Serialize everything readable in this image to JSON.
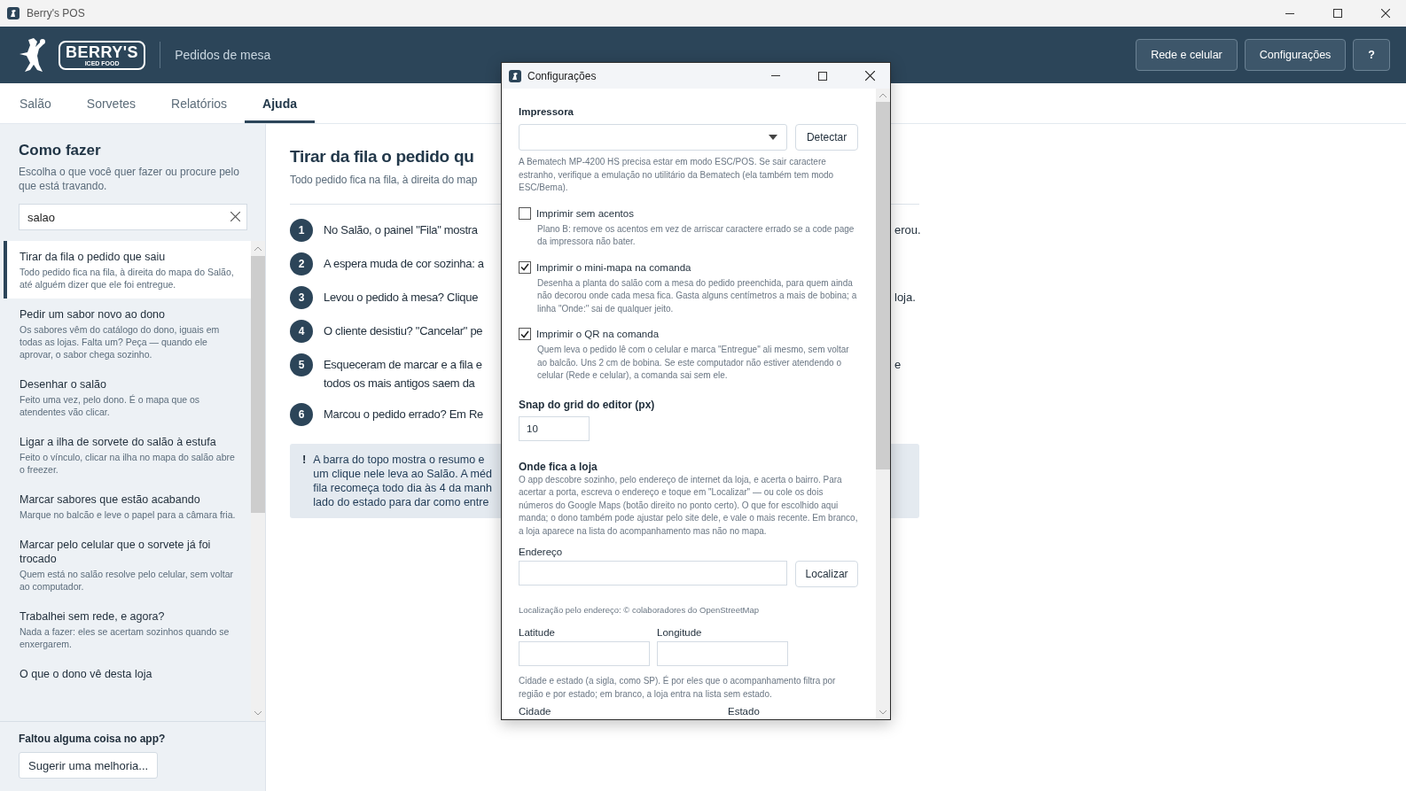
{
  "app_window": {
    "title": "Berry's POS"
  },
  "header": {
    "brand": "BERRY'S",
    "brand_sub": "ICED FOOD",
    "section": "Pedidos de mesa",
    "buttons": [
      "Rede e celular",
      "Configurações",
      "?"
    ]
  },
  "tabs": [
    {
      "label": "Salão",
      "selected": false
    },
    {
      "label": "Sorvetes",
      "selected": false
    },
    {
      "label": "Relatórios",
      "selected": false
    },
    {
      "label": "Ajuda",
      "selected": true
    }
  ],
  "sidebar": {
    "title": "Como fazer",
    "subtitle": "Escolha o que você quer fazer ou procure pelo que está travando.",
    "search": {
      "value": "salao"
    },
    "items": [
      {
        "title": "Tirar da fila o pedido que saiu",
        "description": "Todo pedido fica na fila, à direita do mapa do Salão, até alguém dizer que ele foi entregue.",
        "selected": true
      },
      {
        "title": "Pedir um sabor novo ao dono",
        "description": "Os sabores vêm do catálogo do dono, iguais em todas as lojas. Falta um? Peça — quando ele aprovar, o sabor chega sozinho.",
        "selected": false
      },
      {
        "title": "Desenhar o salão",
        "description": "Feito uma vez, pelo dono. É o mapa que os atendentes vão clicar.",
        "selected": false
      },
      {
        "title": "Ligar a ilha de sorvete do salão à estufa",
        "description": "Feito o vínculo, clicar na ilha no mapa do salão abre o freezer.",
        "selected": false
      },
      {
        "title": "Marcar sabores que estão acabando",
        "description": "Marque no balcão e leve o papel para a câmara fria.",
        "selected": false
      },
      {
        "title": "Marcar pelo celular que o sorvete já foi trocado",
        "description": "Quem está no salão resolve pelo celular, sem voltar ao computador.",
        "selected": false
      },
      {
        "title": "Trabalhei sem rede, e agora?",
        "description": "Nada a fazer: eles se acertam sozinhos quando se enxergarem.",
        "selected": false
      },
      {
        "title": "O que o dono vê desta loja",
        "selected": false
      }
    ],
    "footer": {
      "prompt": "Faltou alguma coisa no app?",
      "button": "Sugerir uma melhoria..."
    }
  },
  "article": {
    "title": "Tirar da fila o pedido qu",
    "subtitle": "Todo pedido fica na fila, à direita do map",
    "steps": [
      {
        "number": "1",
        "lines": [
          "No Salão, o painel \"Fila\" mostra"
        ],
        "tail": "erou."
      },
      {
        "number": "2",
        "lines": [
          "A espera muda de cor sozinha: a"
        ]
      },
      {
        "number": "3",
        "lines": [
          "Levou o pedido à mesa? Clique"
        ],
        "tail": "loja."
      },
      {
        "number": "4",
        "lines": [
          "O cliente desistiu? \"Cancelar\" pe"
        ]
      },
      {
        "number": "5",
        "lines": [
          "Esqueceram de marcar e a fila e",
          "todos os mais antigos saem da"
        ],
        "tail": "e"
      },
      {
        "number": "6",
        "lines": [
          "Marcou o pedido errado? Em Re"
        ]
      }
    ],
    "notice": {
      "mark": "!",
      "lines": [
        "A barra do topo mostra o resumo e",
        "um clique nele leva ao Salão. A méd",
        "fila recomeça todo dia às 4 da manh",
        "lado do estado para dar como entre"
      ]
    }
  },
  "dialog": {
    "title": "Configurações",
    "printer": {
      "label": "Impressora",
      "button": "Detectar",
      "help": "A Bematech MP-4200 HS precisa estar em modo ESC/POS. Se sair caractere estranho, verifique a emulação no utilitário da Bematech (ela também tem modo ESC/Bema)."
    },
    "options": [
      {
        "label": "Imprimir sem acentos",
        "checked": false,
        "help": "Plano B: remove os acentos em vez de arriscar caractere errado se a code page da impressora não bater."
      },
      {
        "label": "Imprimir o mini-mapa na comanda",
        "checked": true,
        "help": "Desenha a planta do salão com a mesa do pedido preenchida, para quem ainda não decorou onde cada mesa fica. Gasta alguns centímetros a mais de bobina; a linha \"Onde:\" sai de qualquer jeito."
      },
      {
        "label": "Imprimir o QR na comanda",
        "checked": true,
        "help": "Quem leva o pedido lê com o celular e marca \"Entregue\" ali mesmo, sem voltar ao balcão. Uns 2 cm de bobina. Se este computador não estiver atendendo o celular (Rede e celular), a comanda sai sem ele."
      }
    ],
    "snap": {
      "label": "Snap do grid do editor (px)",
      "value": "10"
    },
    "location": {
      "title": "Onde fica a loja",
      "help": "O app descobre sozinho, pelo endereço de internet da loja, e acerta o bairro. Para acertar a porta, escreva o endereço e toque em \"Localizar\" — ou cole os dois números do Google Maps (botão direito no ponto certo). O que for escolhido aqui manda; o dono também pode ajustar pelo site dele, e vale o mais recente. Em branco, a loja aparece na lista do acompanhamento mas não no mapa.",
      "address_label": "Endereço",
      "locate_button": "Localizar",
      "attribution": "Localização pelo endereço: © colaboradores do OpenStreetMap",
      "latitude_label": "Latitude",
      "longitude_label": "Longitude",
      "region_help": "Cidade e estado (a sigla, como SP). É por eles que o acompanhamento filtra por região e por estado; em branco, a loja entra na lista sem estado.",
      "city_label": "Cidade",
      "state_label": "Estado"
    }
  }
}
